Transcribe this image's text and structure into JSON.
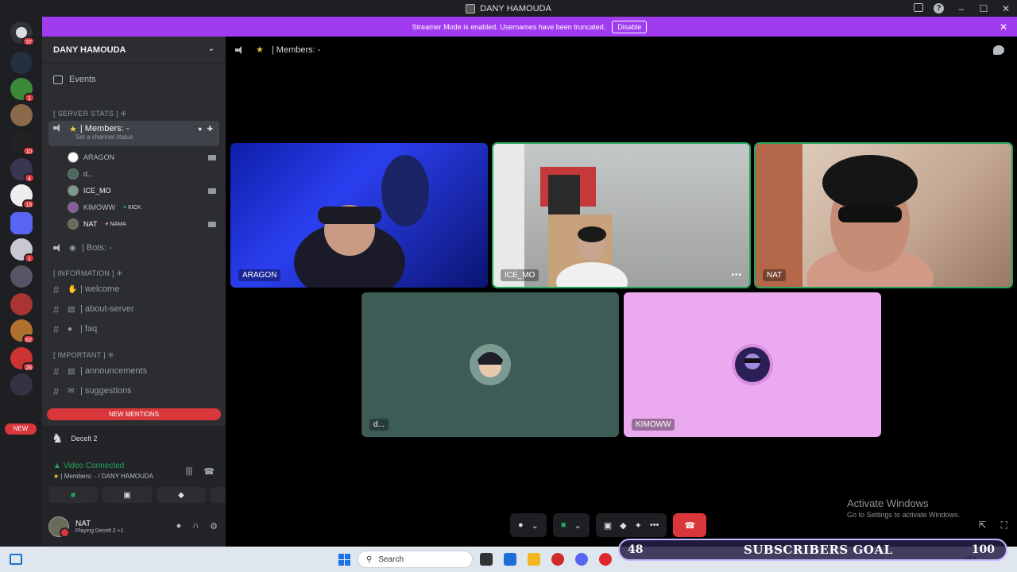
{
  "window": {
    "title": "DANY HAMOUDA"
  },
  "banner": {
    "text": "Streamer Mode is enabled. Usernames have been truncated.",
    "disable_label": "Disable"
  },
  "guilds": {
    "home_badge": "37",
    "new_label": "NEW",
    "badges": [
      "1",
      "10",
      "4",
      "13",
      "1",
      "62",
      "28"
    ]
  },
  "sidebar": {
    "server_name": "DANY HAMOUDA",
    "events_label": "Events",
    "categories": {
      "server_stats": "[ SERVER STATS ] ⁜",
      "information": "[ INFORMATION ] ⁜",
      "important": "[ IMPORTANT ] ⁜"
    },
    "voice_channel": {
      "name": "| Members: -",
      "status_hint": "Set a channel status"
    },
    "members": [
      {
        "name": "ARAGON",
        "tag": ""
      },
      {
        "name": "d...",
        "tag": ""
      },
      {
        "name": "ICE_MO",
        "tag": ""
      },
      {
        "name": "KIMOWW",
        "tag": "KICK"
      },
      {
        "name": "NAT",
        "tag": "NAMA"
      }
    ],
    "bots_channel": "| Bots: -",
    "channels_info": [
      "| welcome",
      "| about-server",
      "| faq"
    ],
    "channels_important": [
      "| announcements",
      "| suggestions"
    ],
    "new_mentions": "NEW MENTIONS"
  },
  "activity": {
    "game": "Decelt 2"
  },
  "voice_panel": {
    "status": "Video Connected",
    "channel": "| Members: - / DANY HAMOUDA"
  },
  "user": {
    "name": "NAT",
    "activity": "Playing Decelt 2 +1"
  },
  "stage": {
    "header": "| Members: -",
    "tiles": [
      {
        "name": "ARAGON"
      },
      {
        "name": "ICE_MO"
      },
      {
        "name": "NAT"
      },
      {
        "name": "d..."
      },
      {
        "name": "KIMOWW"
      }
    ],
    "windows_activation": {
      "title": "Activate Windows",
      "subtitle": "Go to Settings to activate Windows."
    }
  },
  "taskbar": {
    "search_placeholder": "Search",
    "tray_lang": "FRA"
  },
  "overlay": {
    "current": "48",
    "label": "SUBSCRIBERS GOAL",
    "goal": "100"
  },
  "colors": {
    "banner": "#a13bf0",
    "accent_red": "#da373c",
    "speaking_green": "#23a55a",
    "tile_teal": "#3e5c56",
    "tile_pink": "#eba9ef"
  }
}
